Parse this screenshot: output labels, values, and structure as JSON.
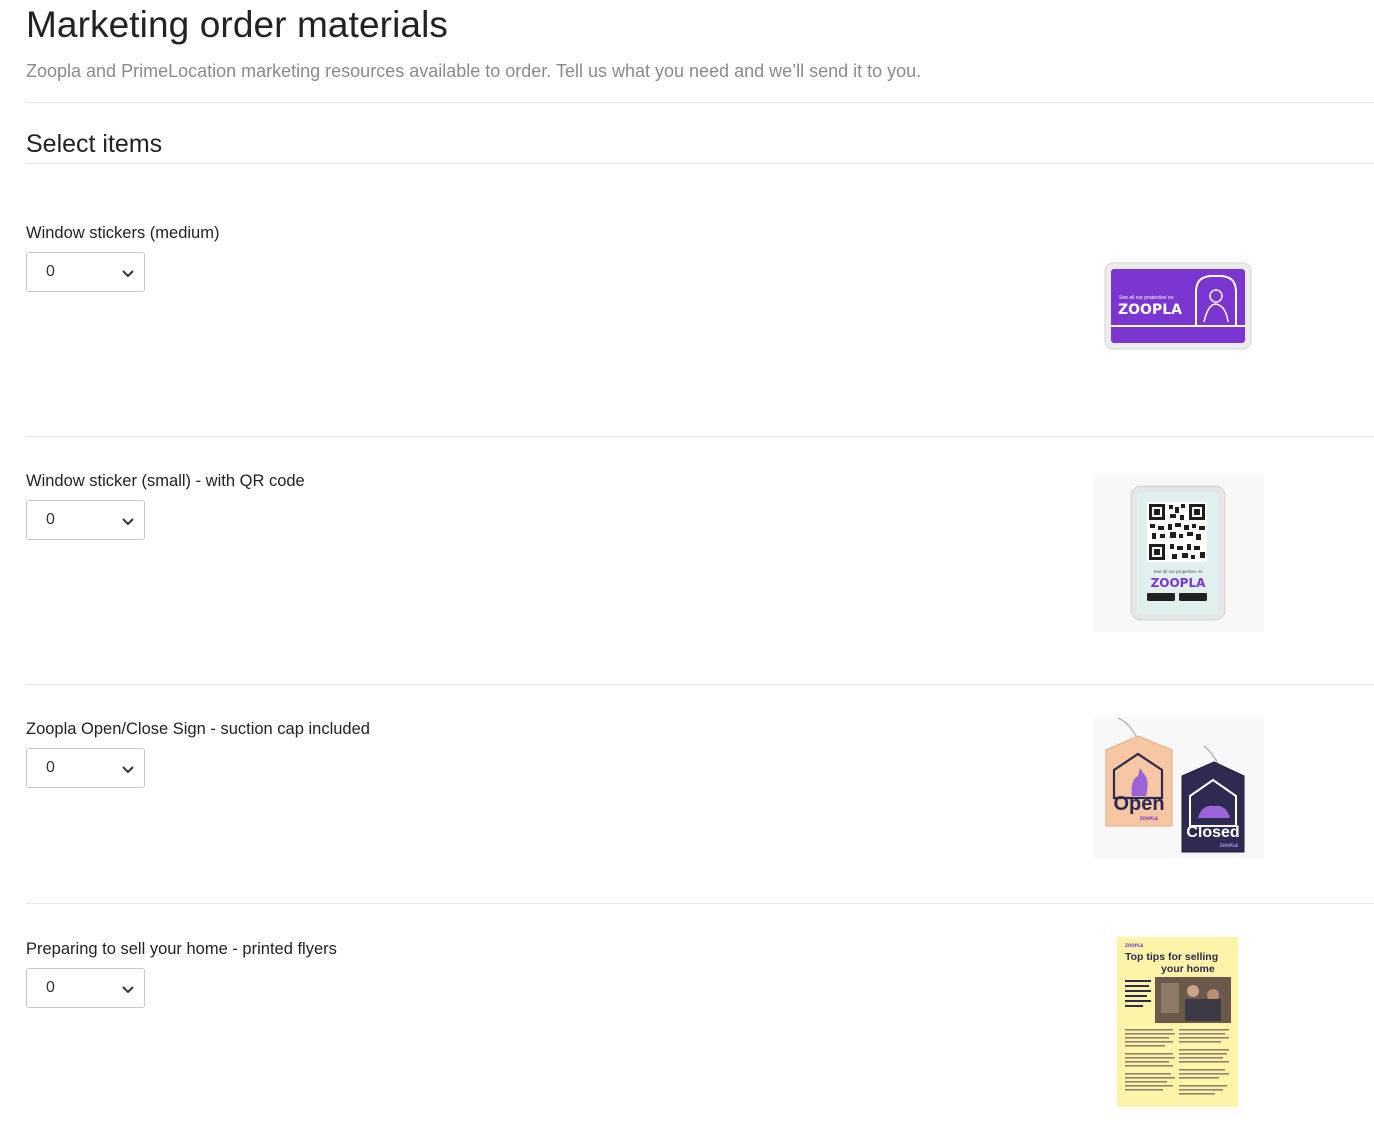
{
  "page": {
    "title": "Marketing order materials",
    "subtitle": "Zoopla and PrimeLocation marketing resources available to order. Tell us what you need and we’ll send it to you.",
    "section_title": "Select items"
  },
  "items": [
    {
      "label": "Window stickers (medium)",
      "quantity": "0",
      "image": {
        "icon": "zoopla-window-sticker-medium",
        "caption_small": "See all our properties on",
        "brand": "ZOOPLA",
        "color": "#7b35d0"
      }
    },
    {
      "label": "Window sticker (small) - with QR code",
      "quantity": "0",
      "image": {
        "icon": "zoopla-qr-sticker",
        "caption_small": "See all our properties on",
        "brand": "ZOOPLA",
        "color": "#7b35d0"
      }
    },
    {
      "label": "Zoopla Open/Close Sign - suction cap included",
      "quantity": "0",
      "image": {
        "icon": "zoopla-open-closed-sign",
        "open_text": "Open",
        "closed_text": "Closed",
        "brand": "ZOOPLA",
        "open_color": "#f7c6a3",
        "closed_color": "#2e2a52"
      }
    },
    {
      "label": "Preparing to sell your home - printed flyers",
      "quantity": "0",
      "image": {
        "icon": "zoopla-selling-tips-flyer",
        "brand": "ZOOPLA",
        "headline": "Top tips for selling your home",
        "color": "#fdf4a8"
      }
    }
  ]
}
